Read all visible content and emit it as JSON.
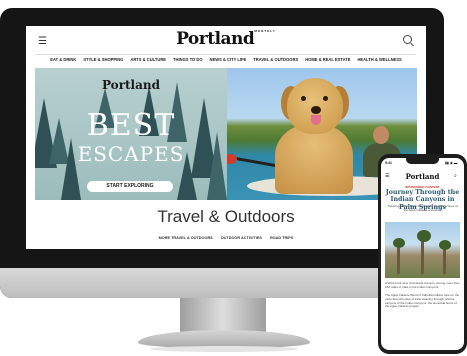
{
  "site": {
    "logo": "Portland",
    "logo_small": "MONTHLY",
    "nav": [
      "EAT & DRINK",
      "STYLE & SHOPPING",
      "ARTS & CULTURE",
      "THINGS TO DO",
      "NEWS & CITY LIFE",
      "TRAVEL & OUTDOORS",
      "HOME & REAL ESTATE",
      "HEALTH & WELLNESS"
    ]
  },
  "hero": {
    "brand": "Portland",
    "headline_line1": "BEST",
    "headline_line2": "ESCAPES",
    "cta_label": "START EXPLORING"
  },
  "section": {
    "title": "Travel & Outdoors",
    "subnav": [
      "MORE TRAVEL & OUTDOORS",
      "OUTDOOR ACTIVITIES",
      "ROAD TRIPS"
    ]
  },
  "phone": {
    "status_time": "9:41",
    "signal": "▮▮ ◉ ▬",
    "logo": "Portland",
    "sponsored": "SPONSORED CONTENT",
    "title": "Journey Through the Indian Canyons in Palm Springs",
    "description": "Towering palms, flowering yuccas, and the echoes of the Agua Caliente ancestors",
    "caption": "A West Fork view of Andreas Canyon, among more than 150 miles of trails in the Indian Canyons.",
    "body": "The Agua Caliente Band of Cahuilla Indians care for the more than 60 miles of trails weaving through pristine canyons of the Indian Canyons, the ancestral home of the Agua Caliente people."
  },
  "icons": {
    "menu": "☰",
    "search": "⌕"
  }
}
